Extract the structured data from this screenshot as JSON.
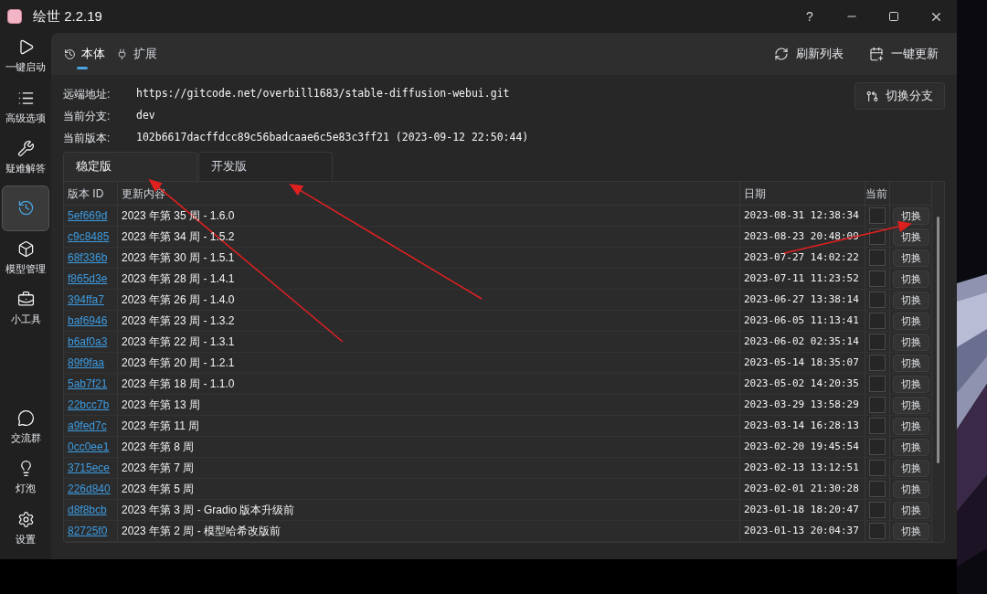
{
  "window": {
    "title": "绘世 2.2.19",
    "controls": [
      "?"
    ]
  },
  "sidebar": {
    "items": [
      {
        "label": "一键启动",
        "selected": false
      },
      {
        "label": "高级选项",
        "selected": false
      },
      {
        "label": "疑难解答",
        "selected": false
      },
      {
        "selected": true
      },
      {
        "label": "模型管理",
        "selected": false
      },
      {
        "label": "小工具",
        "selected": false
      }
    ],
    "bottom_items": [
      {
        "label": "交流群",
        "selected": false
      },
      {
        "label": "灯泡",
        "selected": false
      },
      {
        "label": "设置",
        "selected": false
      }
    ]
  },
  "tabs": [
    {
      "label": "本体",
      "selected": true
    },
    {
      "label": "扩展",
      "selected": false
    }
  ],
  "toolbar": [
    {
      "label": "刷新列表"
    },
    {
      "label": "一键更新"
    }
  ],
  "info": [
    {
      "label": "远端地址:",
      "value": "https://gitcode.net/overbill1683/stable-diffusion-webui.git"
    },
    {
      "label": "当前分支:",
      "value": "dev"
    },
    {
      "label": "当前版本:",
      "value": "102b6617dacffdcc89c56badcaae6c5e83c3ff21 (2023-09-12 22:50:44)"
    }
  ],
  "switch_branch_button": "切换分支",
  "version_tabs": [
    {
      "label": "稳定版",
      "selected": true
    },
    {
      "label": "开发版",
      "selected": false
    }
  ],
  "table": {
    "columns": [
      "版本 ID",
      "更新内容",
      "日期",
      "当前"
    ],
    "rows": [
      {
        "id": "5ef669d",
        "content": "2023 年第 35 周 - 1.6.0",
        "date": "2023-08-31 12:38:34",
        "current": false,
        "action": "切换"
      },
      {
        "id": "c9c8485",
        "content": "2023 年第 34 周 - 1.5.2",
        "date": "2023-08-23 20:48:09",
        "current": false,
        "action": "切换"
      },
      {
        "id": "68f336b",
        "content": "2023 年第 30 周 - 1.5.1",
        "date": "2023-07-27 14:02:22",
        "current": false,
        "action": "切换"
      },
      {
        "id": "f865d3e",
        "content": "2023 年第 28 周 - 1.4.1",
        "date": "2023-07-11 11:23:52",
        "current": false,
        "action": "切换"
      },
      {
        "id": "394ffa7",
        "content": "2023 年第 26 周 - 1.4.0",
        "date": "2023-06-27 13:38:14",
        "current": false,
        "action": "切换"
      },
      {
        "id": "baf6946",
        "content": "2023 年第 23 周 - 1.3.2",
        "date": "2023-06-05 11:13:41",
        "current": false,
        "action": "切换"
      },
      {
        "id": "b6af0a3",
        "content": "2023 年第 22 周 - 1.3.1",
        "date": "2023-06-02 02:35:14",
        "current": false,
        "action": "切换"
      },
      {
        "id": "89f9faa",
        "content": "2023 年第 20 周 - 1.2.1",
        "date": "2023-05-14 18:35:07",
        "current": false,
        "action": "切换"
      },
      {
        "id": "5ab7f21",
        "content": "2023 年第 18 周 - 1.1.0",
        "date": "2023-05-02 14:20:35",
        "current": false,
        "action": "切换"
      },
      {
        "id": "22bcc7b",
        "content": "2023 年第 13 周",
        "date": "2023-03-29 13:58:29",
        "current": false,
        "action": "切换"
      },
      {
        "id": "a9fed7c",
        "content": "2023 年第 11 周",
        "date": "2023-03-14 16:28:13",
        "current": false,
        "action": "切换"
      },
      {
        "id": "0cc0ee1",
        "content": "2023 年第 8 周",
        "date": "2023-02-20 19:45:54",
        "current": false,
        "action": "切换"
      },
      {
        "id": "3715ece",
        "content": "2023 年第 7 周",
        "date": "2023-02-13 13:12:51",
        "current": false,
        "action": "切换"
      },
      {
        "id": "226d840",
        "content": "2023 年第 5 周",
        "date": "2023-02-01 21:30:28",
        "current": false,
        "action": "切换"
      },
      {
        "id": "d8f8bcb",
        "content": "2023 年第 3 周 - Gradio 版本升级前",
        "date": "2023-01-18 18:20:47",
        "current": false,
        "action": "切换"
      },
      {
        "id": "82725f0",
        "content": "2023 年第 2 周 - 模型哈希改版前",
        "date": "2023-01-13 20:04:37",
        "current": false,
        "action": "切换"
      }
    ]
  }
}
